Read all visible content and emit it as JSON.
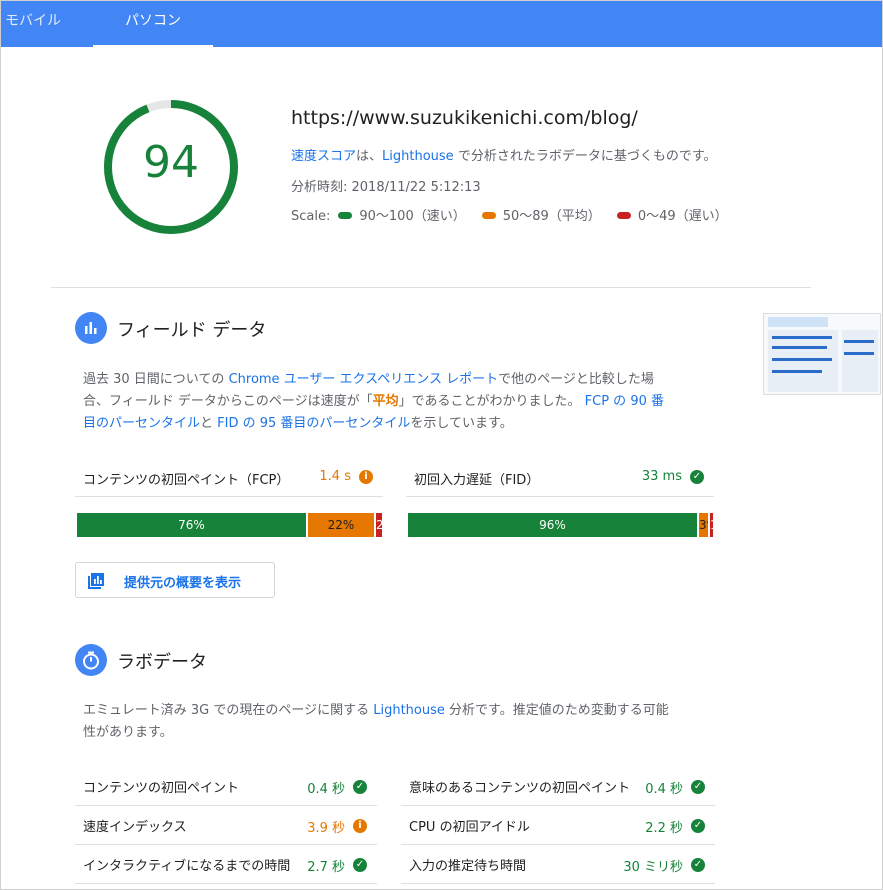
{
  "tabs": {
    "mobile": "モバイル",
    "desktop": "パソコン"
  },
  "summary": {
    "score": "94",
    "score_fraction": 0.94,
    "url": "https://www.suzukikenichi.com/blog/",
    "desc_link1": "速度スコア",
    "desc_mid": "は、",
    "desc_link2": "Lighthouse",
    "desc_tail": " で分析されたラボデータに基づくものです。",
    "time": "分析時刻: 2018/11/22 5:12:13",
    "scale_label": "Scale:",
    "scale_fast": "90〜100（速い）",
    "scale_avg": "50〜89（平均）",
    "scale_slow": "0〜49（遅い）"
  },
  "colors": {
    "fast": "#178239",
    "average": "#e67700",
    "slow": "#c7221f",
    "accent": "#4285f4"
  },
  "field": {
    "title": "フィールド データ",
    "p1": "過去 30 日間についての ",
    "p_link1": "Chrome ユーザー エクスペリエンス レポート",
    "p2": "で他のページと比較した場",
    "p3": "合、フィールド データからこのページは速度が「",
    "p_avg": "平均",
    "p4": "」であることがわかりました。 ",
    "p_link2": "FCP の 90 番",
    "p_link3": "目のパーセンタイル",
    "p5": "と ",
    "p_link4": "FID の 95 番目のパーセンタイル",
    "p6": "を示しています。",
    "fcp": {
      "label": "コンテンツの初回ペイント（FCP）",
      "value": "1.4 s",
      "icon": "info-icon",
      "dist": [
        {
          "label": "76%",
          "value": 76
        },
        {
          "label": "22%",
          "value": 22
        },
        {
          "label": "2%",
          "value": 2
        }
      ]
    },
    "fid": {
      "label": "初回入力遅延（FID）",
      "value": "33 ms",
      "icon": "check-icon",
      "dist": [
        {
          "label": "96%",
          "value": 96
        },
        {
          "label": "3%",
          "value": 3
        },
        {
          "label": "1%",
          "value": 1
        }
      ]
    },
    "source_button": "提供元の概要を表示"
  },
  "lab": {
    "title": "ラボデータ",
    "p1": "エミュレート済み 3G での現在のページに関する ",
    "p_link": "Lighthouse",
    "p2": " 分析です。推定値のため変動する可能",
    "p3": "性があります。",
    "metrics": [
      {
        "label": "コンテンツの初回ペイント",
        "value": "0.4 秒",
        "status": "fast"
      },
      {
        "label": "意味のあるコンテンツの初回ペイント",
        "value": "0.4 秒",
        "status": "fast"
      },
      {
        "label": "速度インデックス",
        "value": "3.9 秒",
        "status": "average"
      },
      {
        "label": "CPU の初回アイドル",
        "value": "2.2 秒",
        "status": "fast"
      },
      {
        "label": "インタラクティブになるまでの時間",
        "value": "2.7 秒",
        "status": "fast"
      },
      {
        "label": "入力の推定待ち時間",
        "value": "30 ミリ秒",
        "status": "fast"
      }
    ]
  }
}
